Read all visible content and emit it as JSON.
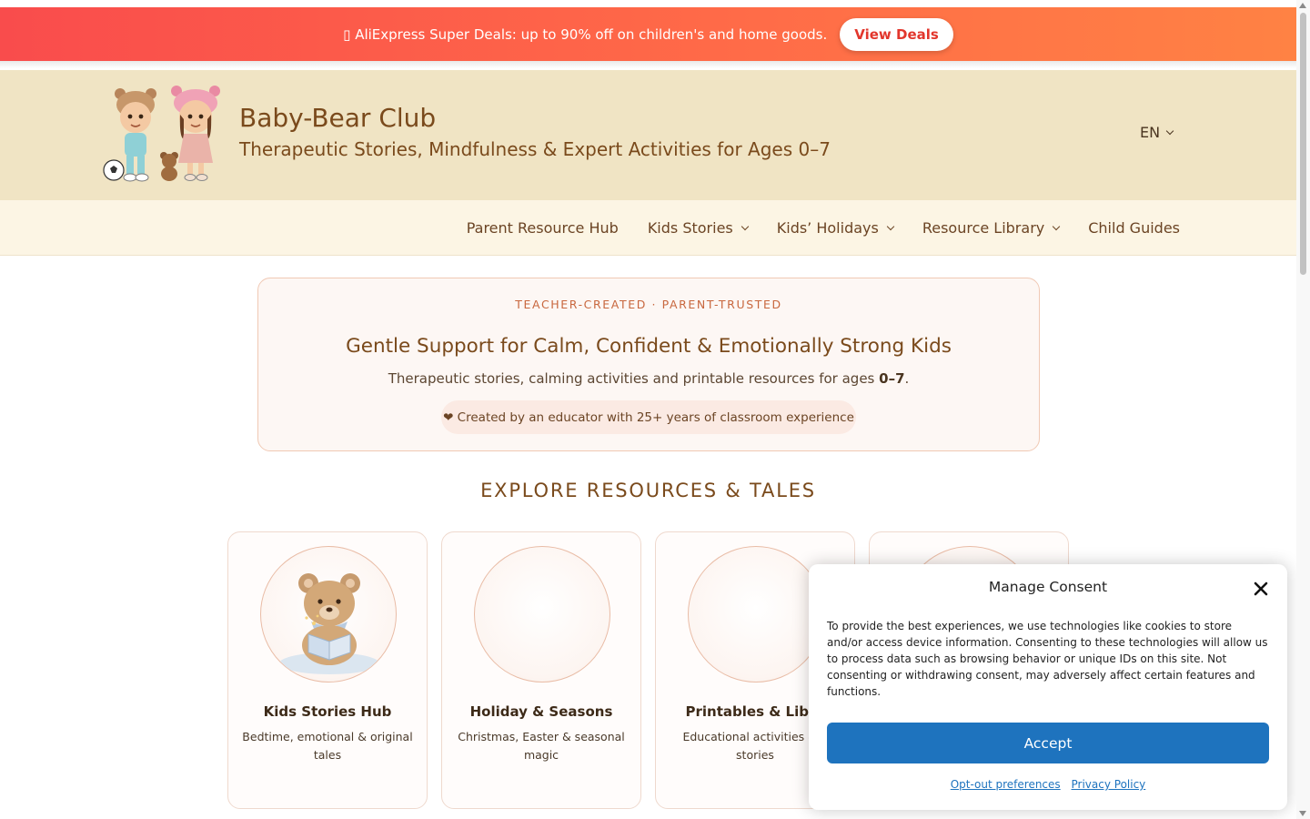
{
  "promo": {
    "icon": "gift-icon",
    "text": "AliExpress Super Deals: up to 90% off on children's and home goods.",
    "button_label": "View Deals",
    "gradient_start": "#f94c4c",
    "gradient_end": "#ff8244"
  },
  "header": {
    "title": "Baby-Bear Club",
    "tagline": "Therapeutic Stories, Mindfulness & Expert Activities for Ages 0–7",
    "language": "EN",
    "background": "#f0e4c4"
  },
  "nav": {
    "items": [
      {
        "label": "Parent Resource Hub",
        "has_dropdown": false
      },
      {
        "label": "Kids Stories",
        "has_dropdown": true
      },
      {
        "label": "Kids’ Holidays",
        "has_dropdown": true
      },
      {
        "label": "Resource Library",
        "has_dropdown": true
      },
      {
        "label": "Child Guides",
        "has_dropdown": false
      }
    ]
  },
  "hero": {
    "kicker": "TEACHER-CREATED · PARENT-TRUSTED",
    "title": "Gentle Support for Calm, Confident & Emotionally Strong Kids",
    "subtitle_prefix": "Therapeutic stories, calming activities and printable resources for ages ",
    "subtitle_ages": "0–7",
    "subtitle_suffix": ".",
    "badge": "❤ Created by an educator with 25+ years of classroom experience"
  },
  "section": {
    "heading": "EXPLORE RESOURCES & TALES"
  },
  "cards": [
    {
      "title": "Kids Stories Hub",
      "description": "Bedtime, emotional & original tales",
      "image": "teddy-bear-reading-icon"
    },
    {
      "title": "Holiday & Seasons",
      "description": "Christmas, Easter & seasonal magic",
      "image": ""
    },
    {
      "title": "Printables & Libra",
      "description": "Educational activities & a stories",
      "image": ""
    },
    {
      "title": "",
      "description": "",
      "image": ""
    }
  ],
  "consent": {
    "title": "Manage Consent",
    "body": "To provide the best experiences, we use technologies like cookies to store and/or access device information. Consenting to these technologies will allow us to process data such as browsing behavior or unique IDs on this site. Not consenting or withdrawing consent, may adversely affect certain features and functions.",
    "accept_label": "Accept",
    "optout_label": "Opt-out preferences",
    "privacy_label": "Privacy Policy",
    "accent": "#1e73be"
  }
}
